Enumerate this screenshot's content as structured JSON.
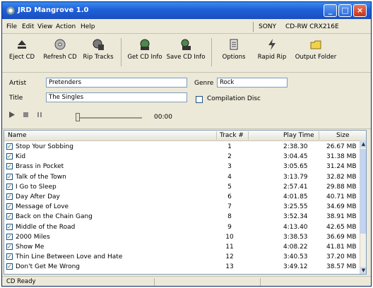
{
  "window": {
    "title": "JRD Mangrove 1.0"
  },
  "menu": {
    "items": [
      {
        "label": "File"
      },
      {
        "label": "Edit"
      },
      {
        "label": "View"
      },
      {
        "label": "Action"
      },
      {
        "label": "Help"
      }
    ],
    "drive_vendor": "SONY",
    "drive_model": "CD-RW CRX216E"
  },
  "toolbar": {
    "buttons": [
      {
        "label": "Eject CD",
        "icon": "eject-icon"
      },
      {
        "label": "Refresh CD",
        "icon": "refresh-cd-icon"
      },
      {
        "label": "Rip Tracks",
        "icon": "rip-tracks-icon"
      },
      {
        "label": "Get CD Info",
        "icon": "get-cd-info-icon"
      },
      {
        "label": "Save CD Info",
        "icon": "save-cd-info-icon"
      },
      {
        "label": "Options",
        "icon": "options-icon"
      },
      {
        "label": "Rapid Rip",
        "icon": "rapid-rip-icon"
      },
      {
        "label": "Output Folder",
        "icon": "output-folder-icon"
      }
    ]
  },
  "album": {
    "artist_label": "Artist",
    "artist_value": "Pretenders",
    "title_label": "Title",
    "title_value": "The Singles",
    "genre_label": "Genre",
    "genre_value": "Rock",
    "compilation_label": "Compilation Disc",
    "time": "00:00"
  },
  "columns": {
    "name": "Name",
    "track": "Track #",
    "play_time": "Play Time",
    "size": "Size"
  },
  "tracks": [
    {
      "name": "Stop Your Sobbing",
      "track": "1",
      "time": "2:38.30",
      "size": "26.67 MB"
    },
    {
      "name": "Kid",
      "track": "2",
      "time": "3:04.45",
      "size": "31.38 MB"
    },
    {
      "name": "Brass in Pocket",
      "track": "3",
      "time": "3:05.65",
      "size": "31.24 MB"
    },
    {
      "name": "Talk of the Town",
      "track": "4",
      "time": "3:13.79",
      "size": "32.82 MB"
    },
    {
      "name": "I Go to Sleep",
      "track": "5",
      "time": "2:57.41",
      "size": "29.88 MB"
    },
    {
      "name": "Day After Day",
      "track": "6",
      "time": "4:01.85",
      "size": "40.71 MB"
    },
    {
      "name": "Message of Love",
      "track": "7",
      "time": "3:25.55",
      "size": "34.69 MB"
    },
    {
      "name": "Back on the Chain Gang",
      "track": "8",
      "time": "3:52.34",
      "size": "38.91 MB"
    },
    {
      "name": "Middle of the Road",
      "track": "9",
      "time": "4:13.40",
      "size": "42.65 MB"
    },
    {
      "name": "2000 Miles",
      "track": "10",
      "time": "3:38.53",
      "size": "36.69 MB"
    },
    {
      "name": "Show Me",
      "track": "11",
      "time": "4:08.22",
      "size": "41.81 MB"
    },
    {
      "name": "Thin Line Between Love and Hate",
      "track": "12",
      "time": "3:40.53",
      "size": "37.20 MB"
    },
    {
      "name": "Don't Get Me Wrong",
      "track": "13",
      "time": "3:49.12",
      "size": "38.57 MB"
    }
  ],
  "status": {
    "text": "CD Ready"
  }
}
